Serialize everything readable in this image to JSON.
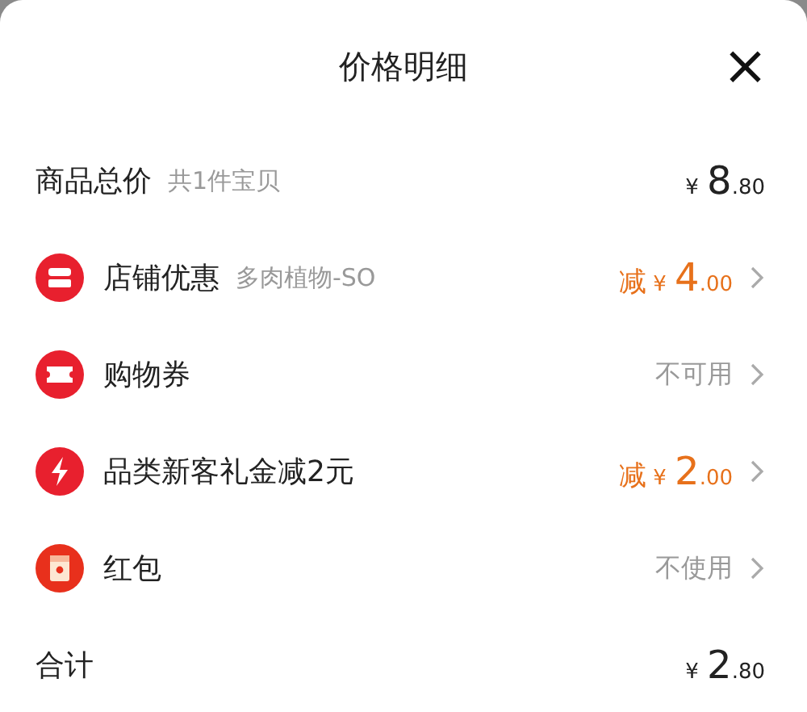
{
  "header": {
    "title": "价格明细",
    "close": "×"
  },
  "rows": [
    {
      "kind": "plain",
      "label": "商品总价",
      "note": "共1件宝贝",
      "amount": {
        "currency": "¥",
        "whole": "8",
        "fraction": ".80"
      }
    },
    {
      "kind": "shop",
      "label": "店铺优惠",
      "note": "多肉植物-SO",
      "amount": {
        "prefix": "减",
        "currency": "¥",
        "whole": "4",
        "fraction": ".00"
      }
    },
    {
      "kind": "ticket",
      "label": "购物券",
      "status": "不可用"
    },
    {
      "kind": "bolt",
      "label": "品类新客礼金减2元",
      "amount": {
        "prefix": "减",
        "currency": "¥",
        "whole": "2",
        "fraction": ".00"
      }
    },
    {
      "kind": "envelope",
      "label": "红包",
      "status": "不使用"
    },
    {
      "kind": "plain",
      "label": "合计",
      "amount": {
        "currency": "¥",
        "whole": "2",
        "fraction": ".80"
      }
    }
  ]
}
